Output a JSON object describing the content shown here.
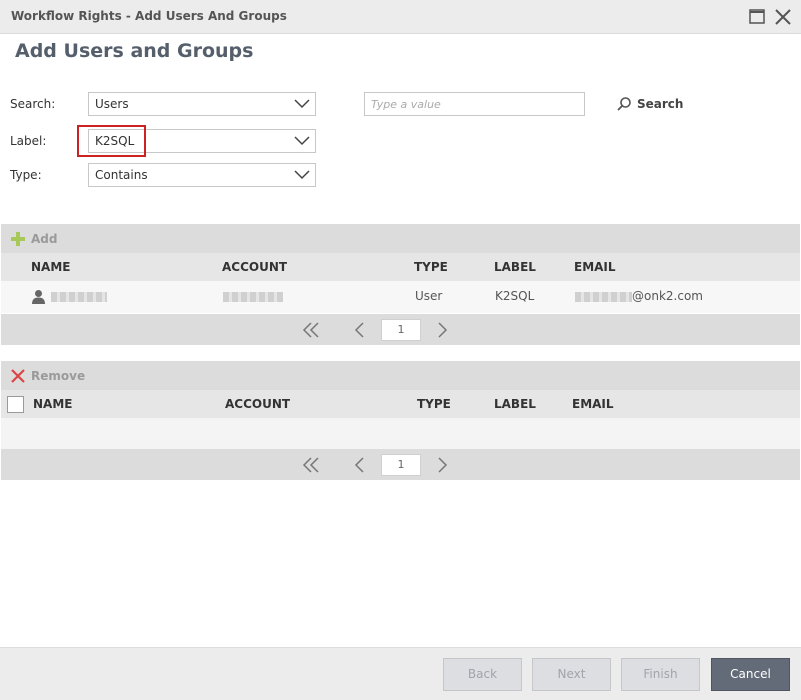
{
  "window": {
    "title": "Workflow Rights - Add Users And Groups",
    "maximize_icon": "maximize-icon",
    "close_icon": "close-icon"
  },
  "page": {
    "heading": "Add Users and Groups"
  },
  "form": {
    "search_label": "Search:",
    "search_value": "Users",
    "label_label": "Label:",
    "label_value": "K2SQL",
    "type_label": "Type:",
    "type_value": "Contains",
    "value_placeholder": "Type a value",
    "search_button": "Search"
  },
  "results": {
    "add_label": "Add",
    "columns": [
      "NAME",
      "ACCOUNT",
      "TYPE",
      "LABEL",
      "EMAIL"
    ],
    "rows": [
      {
        "type": "User",
        "label": "K2SQL",
        "email_suffix": "@onk2.com"
      }
    ],
    "page": "1"
  },
  "selected": {
    "remove_label": "Remove",
    "columns": [
      "NAME",
      "ACCOUNT",
      "TYPE",
      "LABEL",
      "EMAIL"
    ],
    "page": "1"
  },
  "footer": {
    "back": "Back",
    "next": "Next",
    "finish": "Finish",
    "cancel": "Cancel"
  },
  "colors": {
    "highlight": "#cc2222",
    "add_icon": "#a7c95a",
    "remove_icon": "#d44",
    "primary_button": "#636b78"
  }
}
